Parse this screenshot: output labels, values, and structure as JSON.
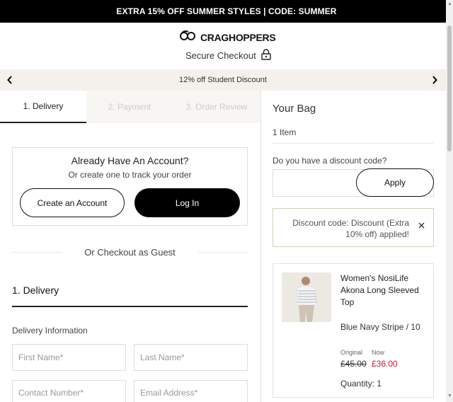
{
  "promo": {
    "text": "EXTRA 15% OFF SUMMER STYLES | CODE: SUMMER"
  },
  "header": {
    "brand": "CRAGHOPPERS",
    "secure_label": "Secure Checkout",
    "icons": {
      "logo": "craghoppers-logo-icon",
      "lock": "lock-icon"
    }
  },
  "carousel": {
    "text": "12% off Student Discount",
    "icons": {
      "prev": "chevron-left-icon",
      "next": "chevron-right-icon"
    }
  },
  "steps": [
    {
      "label": "1. Delivery",
      "active": true
    },
    {
      "label": "2. Payment",
      "active": false
    },
    {
      "label": "3. Order Review",
      "active": false
    }
  ],
  "account": {
    "title": "Already Have An Account?",
    "subtitle": "Or create one to track your order",
    "create_label": "Create an Account",
    "login_label": "Log In"
  },
  "guest": {
    "text": "Or Checkout as Guest"
  },
  "delivery": {
    "heading": "1. Delivery",
    "info_label": "Delivery Information",
    "fields": {
      "first_name": "First Name*",
      "last_name": "Last Name*",
      "contact": "Contact Number*",
      "email": "Email Address*"
    }
  },
  "bag": {
    "title": "Your Bag",
    "count": "1 Item",
    "discount_question": "Do you have a discount code?",
    "apply_label": "Apply",
    "notice": "Discount code: Discount (Extra 10% off) applied!",
    "notice_close_icon": "close-icon",
    "product": {
      "image_icon": "product-thumbnail",
      "name": "Women's NosiLife Akona Long Sleeved Top",
      "variant": "Blue Navy Stripe / 10",
      "original_label": "Original",
      "now_label": "Now",
      "original_price": "£45.00",
      "now_price": "£36.00",
      "quantity": "Quantity: 1"
    }
  },
  "colors": {
    "promo_bg": "#000000",
    "carousel_bg": "#f4f1ec",
    "sale_red": "#c8102e",
    "notice_border": "#c9d6b4"
  }
}
